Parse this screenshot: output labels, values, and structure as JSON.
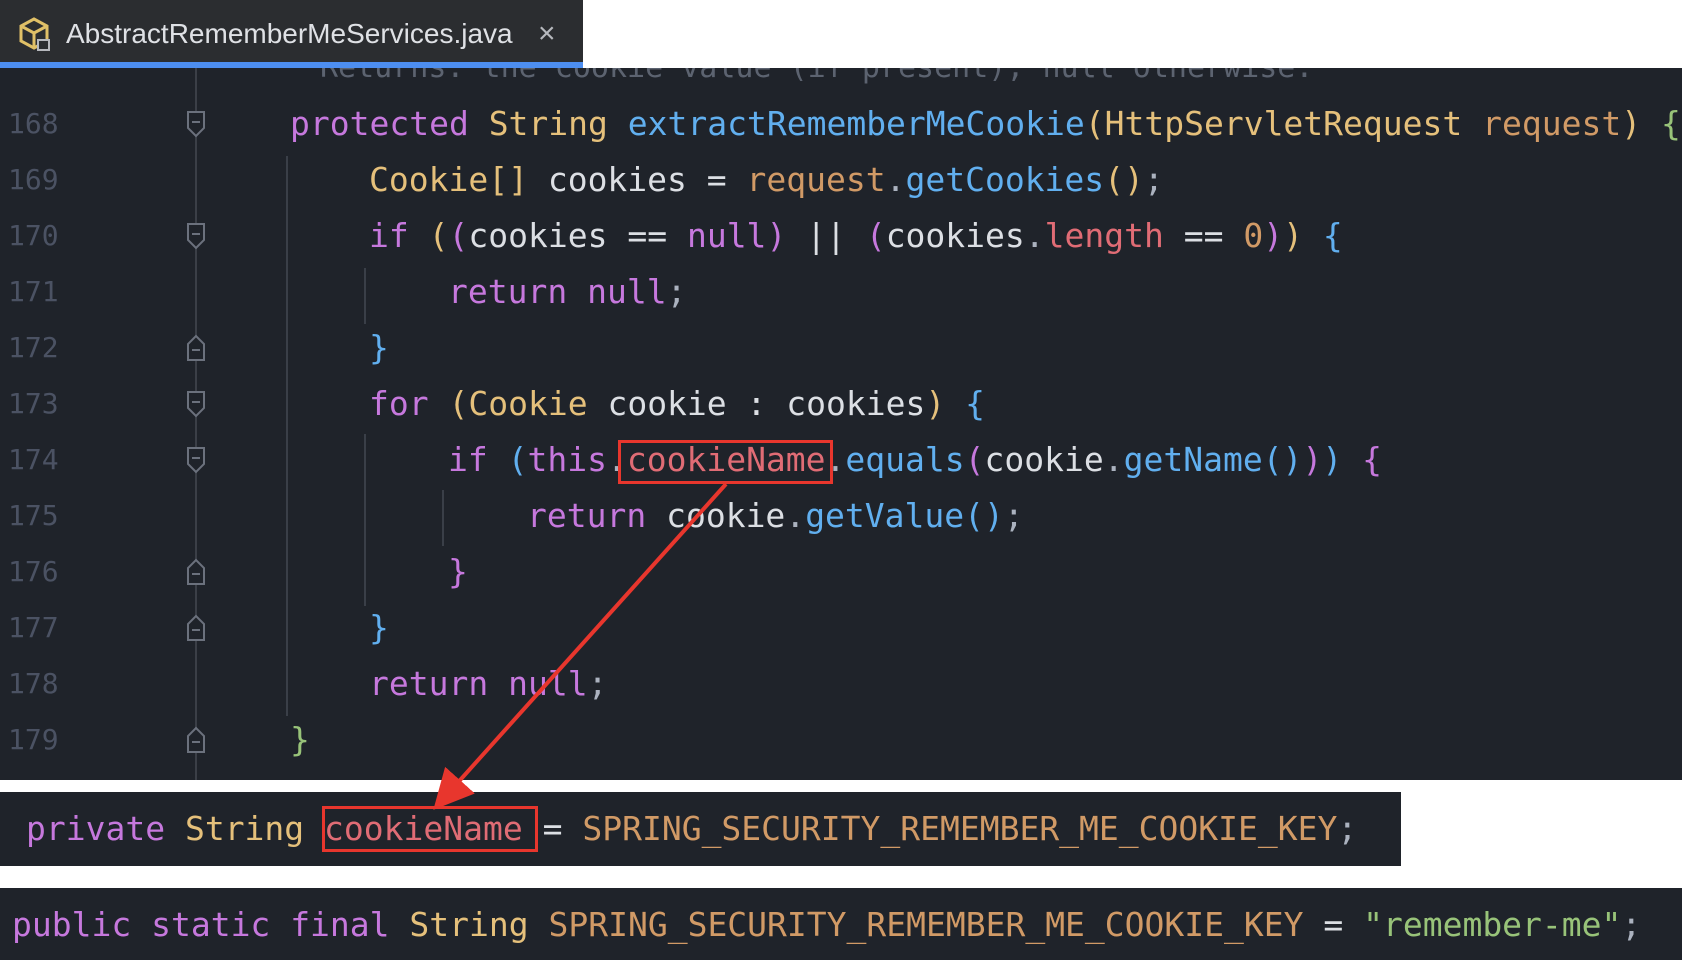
{
  "tab": {
    "title": "AbstractRememberMeServices.java",
    "close": "×",
    "icon": "java-class-icon"
  },
  "editor": {
    "comment_peek": "Returns: the cookie value (if present), null otherwise.",
    "lines": [
      {
        "num": "168"
      },
      {
        "num": "169"
      },
      {
        "num": "170"
      },
      {
        "num": "171"
      },
      {
        "num": "172"
      },
      {
        "num": "173"
      },
      {
        "num": "174"
      },
      {
        "num": "175"
      },
      {
        "num": "176"
      },
      {
        "num": "177"
      },
      {
        "num": "178"
      },
      {
        "num": "179"
      }
    ],
    "tokens": {
      "protected": "protected",
      "String": "String",
      "method": "extractRememberMeCookie",
      "HttpServletRequest": "HttpServletRequest",
      "request": "request",
      "Cookie_arr": "Cookie[]",
      "cookies": "cookies",
      "eq": "=",
      "getCookies": "getCookies",
      "if": "if",
      "null": "null",
      "eqeq": "==",
      "oror": "||",
      "length": "length",
      "zero": "0",
      "return": "return",
      "for": "for",
      "Cookie": "Cookie",
      "cookie": "cookie",
      "colon": ":",
      "this": "this",
      "cookieName": "cookieName",
      "equals": "equals",
      "getName": "getName",
      "getValue": "getValue"
    }
  },
  "snippets": {
    "field": {
      "private": "private",
      "String": "String",
      "cookieName": "cookieName",
      "eq": "=",
      "constant": "SPRING_SECURITY_REMEMBER_ME_COOKIE_KEY",
      "semi": ";"
    },
    "constant": {
      "public": "public",
      "static": "static",
      "final": "final",
      "String": "String",
      "constant": "SPRING_SECURITY_REMEMBER_ME_COOKIE_KEY",
      "eq": "=",
      "value": "\"remember-me\"",
      "semi": ";"
    }
  },
  "colors": {
    "highlight": "#e8362d",
    "tab_accent": "#4d8ef0",
    "editor_bg": "#1f232a"
  }
}
